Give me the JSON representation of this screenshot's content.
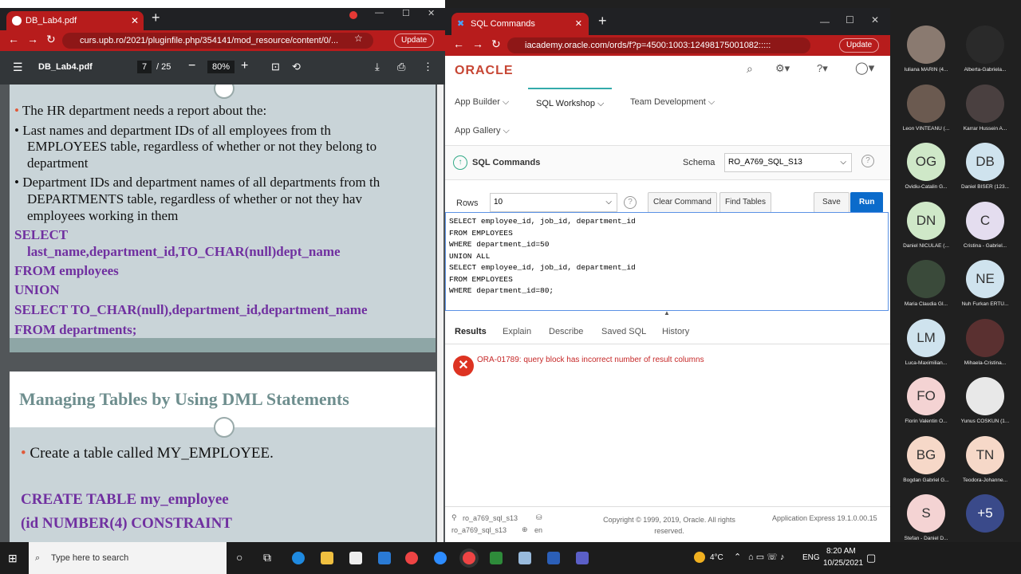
{
  "left_browser": {
    "tab_title": "DB_Lab4.pdf",
    "url": "curs.upb.ro/2021/pluginfile.php/354141/mod_resource/content/0/...",
    "update": "Update",
    "pdf": {
      "filename": "DB_Lab4.pdf",
      "page": "7",
      "pages": "/ 25",
      "zoom": "80%"
    },
    "slide1": {
      "lines": [
        "The HR department needs a report about the:",
        "• Last names and department IDs of all employees from th",
        "EMPLOYEES table, regardless of whether or not they belong to",
        "department",
        "• Department IDs and department names of all departments from th",
        "DEPARTMENTS table, regardless of whether or not they hav",
        "employees working in them"
      ],
      "sql": [
        "SELECT",
        "last_name,department_id,TO_CHAR(null)dept_name",
        "FROM employees",
        "UNION",
        "SELECT TO_CHAR(null),department_id,department_name",
        "FROM departments;"
      ]
    },
    "slide2": {
      "title": "Managing Tables by Using DML Statements",
      "bullet": "Create a table called MY_EMPLOYEE.",
      "sql": [
        "CREATE TABLE my_employee",
        "(id NUMBER(4) CONSTRAINT"
      ]
    }
  },
  "right_browser": {
    "tab_title": "SQL Commands",
    "url": "iacademy.oracle.com/ords/f?p=4500:1003:12498175001082:::::",
    "update": "Update",
    "logo": "ORACLE",
    "menu": [
      "App Builder",
      "SQL Workshop",
      "Team Development",
      "App Gallery"
    ],
    "section": "SQL Commands",
    "schema_label": "Schema",
    "schema_value": "RO_A769_SQL_S13",
    "rows_label": "Rows",
    "rows_value": "10",
    "buttons": {
      "clear": "Clear Command",
      "find": "Find Tables",
      "save": "Save",
      "run": "Run"
    },
    "sql": "SELECT employee_id, job_id, department_id\nFROM EMPLOYEES\nWHERE department_id=50\nUNION ALL\nSELECT employee_id, job_id, department_id\nFROM EMPLOYEES\nWHERE department_id=80;",
    "result_tabs": [
      "Results",
      "Explain",
      "Describe",
      "Saved SQL",
      "History"
    ],
    "error": "ORA-01789: query block has incorrect number of result columns",
    "footer": {
      "user1": "ro_a769_sql_s13",
      "user2": "ro_a769_sql_s13",
      "lang": "en",
      "copyright": "Copyright © 1999, 2019, Oracle. All rights reserved.",
      "version": "Application Express 19.1.0.00.15"
    }
  },
  "participants": [
    {
      "initials": "",
      "name": "Iuliana MARIN (4...",
      "color": "#8a7a70"
    },
    {
      "initials": "",
      "name": "Alberta-Gabriela...",
      "color": "#2a2a2a"
    },
    {
      "initials": "",
      "name": "Leon VINTEANU (...",
      "color": "#6b5a50"
    },
    {
      "initials": "",
      "name": "Karrar Hussein A...",
      "color": "#4a4040"
    },
    {
      "initials": "OG",
      "name": "Ovidiu-Catalin G...",
      "color": "#cfe8c8"
    },
    {
      "initials": "DB",
      "name": "Daniel BISER (123...",
      "color": "#cfe3ee"
    },
    {
      "initials": "DN",
      "name": "Daniel NICULAE (...",
      "color": "#cfe8c8"
    },
    {
      "initials": "C",
      "name": "Cristina - Gabriel...",
      "color": "#e4ddef"
    },
    {
      "initials": "",
      "name": "Maria Claudia GI...",
      "color": "#3a4a3a"
    },
    {
      "initials": "NE",
      "name": "Nuh Furkan ERTÜ...",
      "color": "#cfe3ee"
    },
    {
      "initials": "LM",
      "name": "Luca-Maximilian...",
      "color": "#cfe3ee"
    },
    {
      "initials": "",
      "name": "Mihaela-Cristina...",
      "color": "#5a3030"
    },
    {
      "initials": "FO",
      "name": "Florin Valentin O...",
      "color": "#f4d3d3"
    },
    {
      "initials": "",
      "name": "Yunus COSKUN (1...",
      "color": "#e8e8e8"
    },
    {
      "initials": "BG",
      "name": "Bogdan Gabriel G...",
      "color": "#f6d8c8"
    },
    {
      "initials": "TN",
      "name": "Teodora-Johanne...",
      "color": "#f6d8c8"
    },
    {
      "initials": "S",
      "name": "Stefan - Daniel D...",
      "color": "#f4d3d3"
    },
    {
      "initials": "+5",
      "name": "",
      "color": "#3a4a8a"
    }
  ],
  "taskbar": {
    "search": "Type here to search",
    "temp": "4°C",
    "lang": "ENG",
    "time": "8:20 AM",
    "date": "10/25/2021"
  }
}
